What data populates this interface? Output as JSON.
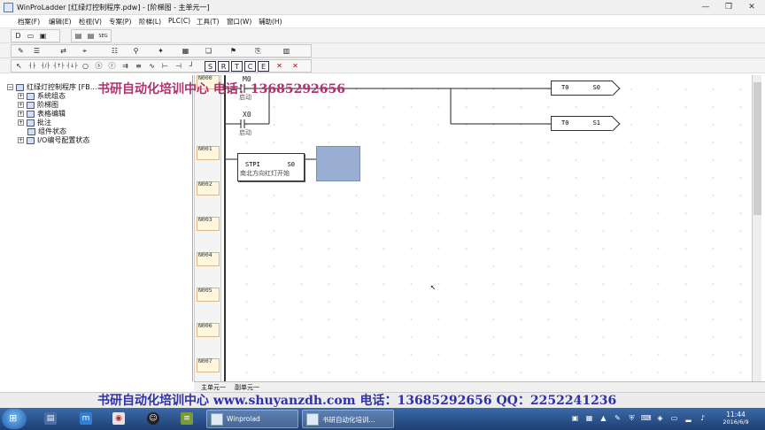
{
  "window": {
    "title": "WinProLadder [红绿灯控制程序.pdw] - [阶梯图 - 主单元一]",
    "controls": [
      "—",
      "❐",
      "✕"
    ]
  },
  "menu": [
    "档案(F)",
    "编辑(E)",
    "检视(V)",
    "专案(P)",
    "阶梯(L)",
    "PLC(C)",
    "工具(T)",
    "窗口(W)",
    "辅助(H)"
  ],
  "toolbar1": [
    "D",
    "▭",
    "▣",
    "▤",
    "SEG",
    "✎",
    "☰",
    "⇄",
    "⌖",
    "☷",
    "⚲",
    "✦",
    "▦",
    "❏",
    "⚑",
    "⎘",
    "▥"
  ],
  "toolbar2": [
    "↖",
    "┤├",
    "┤/├",
    "┤↑├",
    "┤↓├",
    "○",
    "ⓢ",
    "ⓡ",
    "⇉",
    "≡",
    "∿",
    "⊢",
    "⊣",
    "┘",
    "S",
    "R",
    "T",
    "C",
    "E",
    "✕",
    "✕"
  ],
  "tree": {
    "root": "红绿灯控制程序 [FB...",
    "items": [
      "系统组态",
      "阶梯图",
      "表格编辑",
      "批注",
      "组件状态",
      "I/O编号配置状态"
    ]
  },
  "ladder": {
    "rungs": [
      "N000",
      "N001",
      "N002",
      "N003",
      "N004",
      "N005",
      "N006",
      "N007"
    ],
    "contacts": [
      {
        "address": "M0",
        "comment": "启动"
      },
      {
        "address": "X0",
        "comment": "启动"
      }
    ],
    "outputs": [
      {
        "name": "T0",
        "target": "S0"
      },
      {
        "name": "T0",
        "target": "S1"
      }
    ],
    "function_block": {
      "name": "STPI",
      "param": "S0",
      "comment": "南北方向红灯开始"
    }
  },
  "bottom_tabs": [
    "主单元一",
    "副单元一"
  ],
  "status": "",
  "watermark": {
    "top": "书研自动化培训中心 电话：13685292656",
    "bottom": "书研自动化培训中心 www.shuyanzdh.com  电话：13685292656 QQ：2252241236"
  },
  "taskbar": {
    "apps": [
      {
        "label": "Winprolad"
      },
      {
        "label": "书研自动化培训..."
      }
    ],
    "clock_time": "11:44",
    "clock_date": "2016/6/9"
  },
  "colors": {
    "watermark_top": "#b03070",
    "watermark_bottom": "#3030a8",
    "selection": "#9aaed2",
    "taskbar": "#1d3f74"
  }
}
